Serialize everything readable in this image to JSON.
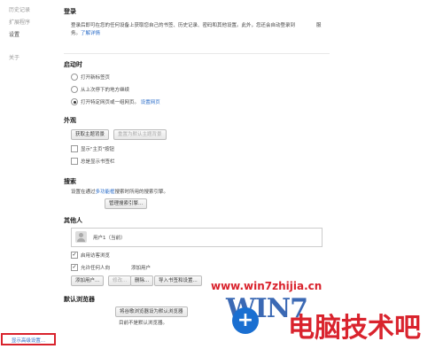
{
  "sidebar": {
    "items": [
      {
        "label": "历史记录"
      },
      {
        "label": "扩展程序"
      },
      {
        "label": "设置"
      },
      {
        "label": "关于"
      }
    ]
  },
  "signin": {
    "title": "登录",
    "desc1": "登录后即可在您的任何设备上获取您自己的书签、历史记录、密码和其他设置。此外，您还会自动登录到",
    "desc1_tail": "服",
    "desc2": "务。",
    "learn_more": "了解详情"
  },
  "startup": {
    "title": "启动时",
    "options": [
      {
        "label": "打开新标签页"
      },
      {
        "label": "从上次停下的地方继续"
      },
      {
        "label": "打开特定网页或一组网页。",
        "link": "设置网页"
      }
    ]
  },
  "appearance": {
    "title": "外观",
    "get_themes": "获取主题背景",
    "reset_theme": "重置为默认主题背景",
    "show_home": "显示\"主页\"按钮",
    "show_bookmarks": "总是显示书签栏"
  },
  "search": {
    "title": "搜索",
    "desc_pre": "设置在通过",
    "desc_link": "多功能框",
    "desc_post": "搜索时所用的搜索引擎。",
    "manage": "管理搜索引擎..."
  },
  "people": {
    "title": "其他人",
    "user": "用户1（当前）",
    "guest": "启用访客浏览",
    "let_anyone": "允许任何人向",
    "add_person_note": "添加用户",
    "buttons": [
      "添加用户...",
      "修改...",
      "删除...",
      "导入书签和设置..."
    ]
  },
  "default_browser": {
    "title": "默认浏览器",
    "make_default": "将谷歌浏览器设为默认浏览器",
    "status": "目前不是默认浏览器。"
  },
  "advanced": {
    "label": "显示高级设置..."
  },
  "watermark": {
    "url": "www.win7zhijia.cn",
    "logo": "WIN7",
    "brand": "电脑技术吧"
  }
}
